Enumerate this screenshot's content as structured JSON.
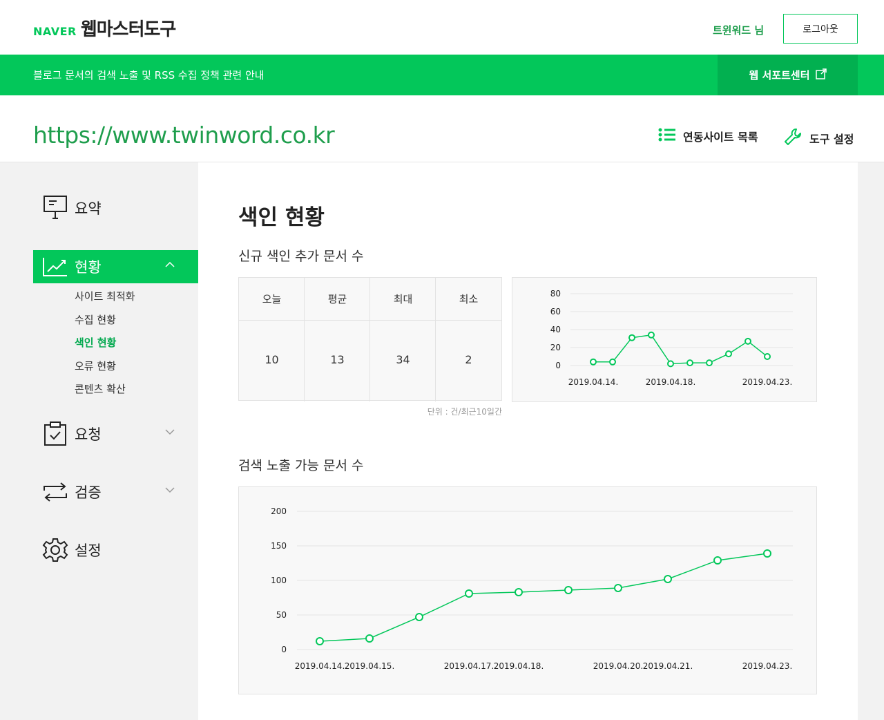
{
  "header": {
    "brand": "NAVER",
    "tool_name": "웹마스터도구",
    "user": "트윈워드 님",
    "logout": "로그아웃"
  },
  "notice": {
    "text": "블로그 문서의 검색 노출 및 RSS 수집 정책 관련 안내",
    "support": "웹 서포트센터"
  },
  "site": {
    "url": "https://www.twinword.co.kr",
    "linked_sites": "연동사이트 목록",
    "tool_settings": "도구 설정"
  },
  "sidebar": {
    "items": [
      {
        "label": "요약",
        "icon": "presentation-icon"
      },
      {
        "label": "현황",
        "icon": "trend-chart-icon",
        "active": true,
        "children": [
          "사이트 최적화",
          "수집 현황",
          "색인 현황",
          "오류 현황",
          "콘텐츠 확산"
        ],
        "current_child": "색인 현황"
      },
      {
        "label": "요청",
        "icon": "clipboard-check-icon"
      },
      {
        "label": "검증",
        "icon": "swap-arrows-icon"
      },
      {
        "label": "설정",
        "icon": "gear-icon"
      }
    ]
  },
  "main": {
    "title": "색인 현황",
    "section1": {
      "title": "신규 색인 추가 문서 수",
      "headers": [
        "오늘",
        "평균",
        "최대",
        "최소"
      ],
      "values": [
        "10",
        "13",
        "34",
        "2"
      ],
      "unit": "단위 : 건/최근10일간"
    },
    "section2": {
      "title": "검색 노출 가능 문서 수"
    }
  },
  "colors": {
    "brand_green": "#03c75a",
    "line_green": "#03c75a",
    "dark_green": "#02b050"
  },
  "chart_data": [
    {
      "type": "line",
      "x": [
        "2019.04.14.",
        "2019.04.15.",
        "2019.04.16.",
        "2019.04.17.",
        "2019.04.18.",
        "2019.04.19.",
        "2019.04.20.",
        "2019.04.21.",
        "2019.04.22.",
        "2019.04.23."
      ],
      "x_tick_labels": [
        "2019.04.14.",
        "2019.04.18.",
        "2019.04.23."
      ],
      "values": [
        4,
        4,
        31,
        34,
        2,
        3,
        3,
        13,
        27,
        10
      ],
      "yticks": [
        0,
        20,
        40,
        60,
        80
      ],
      "ylim": [
        0,
        80
      ],
      "grid": true
    },
    {
      "type": "line",
      "x": [
        "2019.04.14.",
        "2019.04.15.",
        "2019.04.16.",
        "2019.04.17.",
        "2019.04.18.",
        "2019.04.19.",
        "2019.04.20.",
        "2019.04.21.",
        "2019.04.22.",
        "2019.04.23."
      ],
      "x_tick_labels": [
        "2019.04.14.",
        "2019.04.15.",
        "2019.04.17.",
        "2019.04.18.",
        "2019.04.20.",
        "2019.04.21.",
        "2019.04.23."
      ],
      "values": [
        12,
        16,
        47,
        81,
        83,
        86,
        89,
        102,
        129,
        139
      ],
      "yticks": [
        0,
        50,
        100,
        150,
        200
      ],
      "ylim": [
        0,
        200
      ],
      "grid": true
    }
  ]
}
